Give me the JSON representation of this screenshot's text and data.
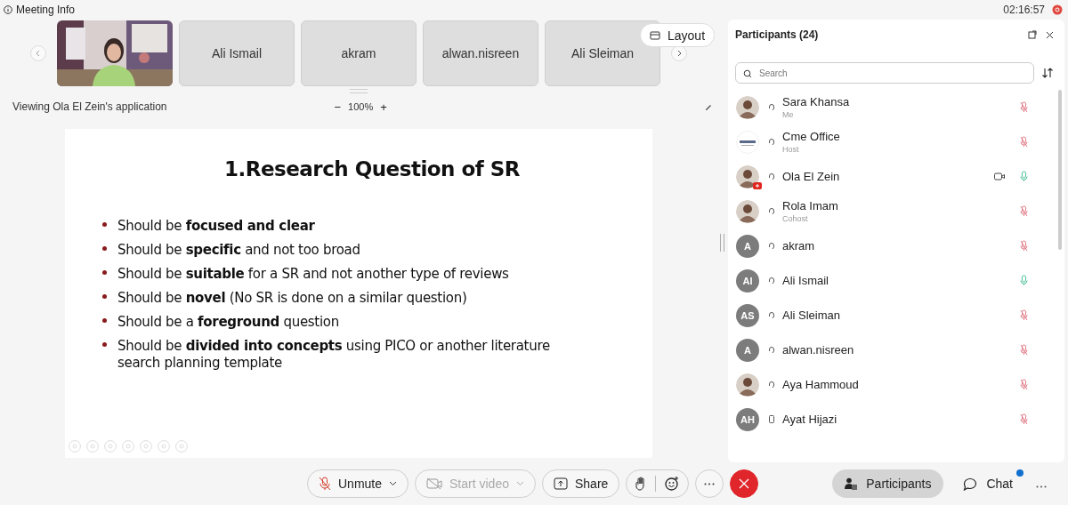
{
  "title_bar": {
    "meeting_info": "Meeting Info",
    "time": "02:16:57"
  },
  "video_strip": {
    "tiles": [
      {
        "kind": "picture"
      },
      {
        "kind": "name",
        "name": "Ali Ismail"
      },
      {
        "kind": "name",
        "name": "akram"
      },
      {
        "kind": "name",
        "name": "alwan.nisreen"
      },
      {
        "kind": "name",
        "name": "Ali Sleiman"
      }
    ],
    "layout_button": "Layout"
  },
  "share_bar": {
    "viewing": "Viewing Ola El Zein's application",
    "zoom_out": "−",
    "zoom": "100%",
    "zoom_in": "+"
  },
  "slide": {
    "title": "1.Research Question of SR",
    "bullets": [
      "Should be **focused and clear**",
      "Should be **specific** and not too broad",
      "Should be **suitable** for a SR and not another type of reviews",
      "Should be **novel** (No SR is done on a similar question)",
      "Should be a **foreground** question",
      "Should be **divided into concepts** using PICO or another literature search planning template"
    ]
  },
  "toolbar": {
    "buttons": [
      {
        "kind": "unmute",
        "label": "Unmute",
        "disabled": false
      },
      {
        "kind": "video",
        "label": "Start video",
        "disabled": true
      },
      {
        "kind": "share",
        "label": "Share",
        "disabled": false
      }
    ]
  },
  "panel": {
    "title": "Participants (24)",
    "search": {
      "placeholder": "Search"
    },
    "participants": [
      {
        "name": "Sara Khansa",
        "role": "Me",
        "phone": false,
        "video": false,
        "muted": true
      },
      {
        "kind": "logo",
        "name": "Cme Office",
        "role": "Host",
        "phone": false,
        "video": false,
        "muted": true
      },
      {
        "name": "Ola El Zein",
        "phone": false,
        "video": true,
        "muted": false
      },
      {
        "name": "Rola Imam",
        "role": "Cohost",
        "phone": false,
        "video": false,
        "muted": true
      },
      {
        "kind": "initials",
        "initials": "A",
        "name": "akram",
        "phone": false,
        "video": false,
        "muted": true
      },
      {
        "kind": "initials",
        "initials": "AI",
        "name": "Ali Ismail",
        "phone": false,
        "video": false,
        "muted": false
      },
      {
        "kind": "initials",
        "initials": "AS",
        "name": "Ali Sleiman",
        "phone": false,
        "video": false,
        "muted": true
      },
      {
        "kind": "initials",
        "initials": "A",
        "name": "alwan.nisreen",
        "phone": false,
        "video": false,
        "muted": true
      },
      {
        "name": "Aya Hammoud",
        "phone": false,
        "video": false,
        "muted": true
      },
      {
        "kind": "initials",
        "initials": "AH",
        "name": "Ayat Hijazi",
        "phone": true,
        "video": false,
        "muted": true
      }
    ]
  },
  "side_buttons": {
    "participants": {
      "label": "Participants",
      "selected": true
    },
    "chat": {
      "label": "Chat",
      "unread": true
    }
  }
}
